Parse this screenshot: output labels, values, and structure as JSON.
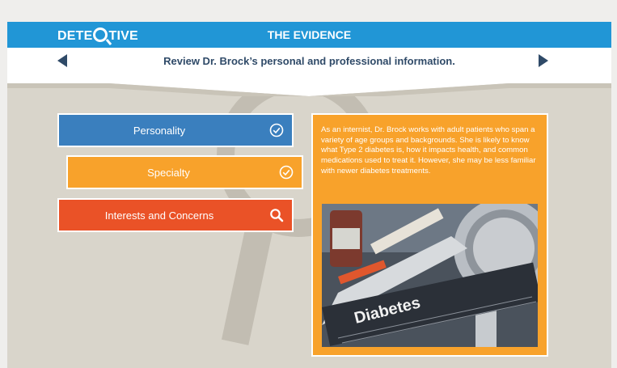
{
  "header": {
    "logo": {
      "part1": "DETE",
      "part2": "TIVE"
    },
    "title": "THE EVIDENCE"
  },
  "subheader": {
    "text": "Review Dr. Brock’s personal and professional information."
  },
  "nav": {
    "prev_icon": "triangle-left-icon",
    "next_icon": "triangle-right-icon"
  },
  "options": [
    {
      "label": "Personality",
      "icon": "check-circle-icon",
      "color": "#3a7fbe"
    },
    {
      "label": "Specialty",
      "icon": "check-circle-icon",
      "color": "#f8a22b"
    },
    {
      "label": "Interests and Concerns",
      "icon": "search-icon",
      "color": "#ea5227"
    }
  ],
  "detail": {
    "text": "As an internist, Dr. Brock works with adult patients who span a variety of age groups and backgrounds. She is likely to know what Type 2 diabetes is, how it impacts health, and common medications used to treat it. However, she may be less familiar with newer diabetes treatments.",
    "image_word": "Diabetes"
  },
  "colors": {
    "header_blue": "#2196d6",
    "subtitle_navy": "#2f4a68",
    "background": "#d9d5cb"
  }
}
